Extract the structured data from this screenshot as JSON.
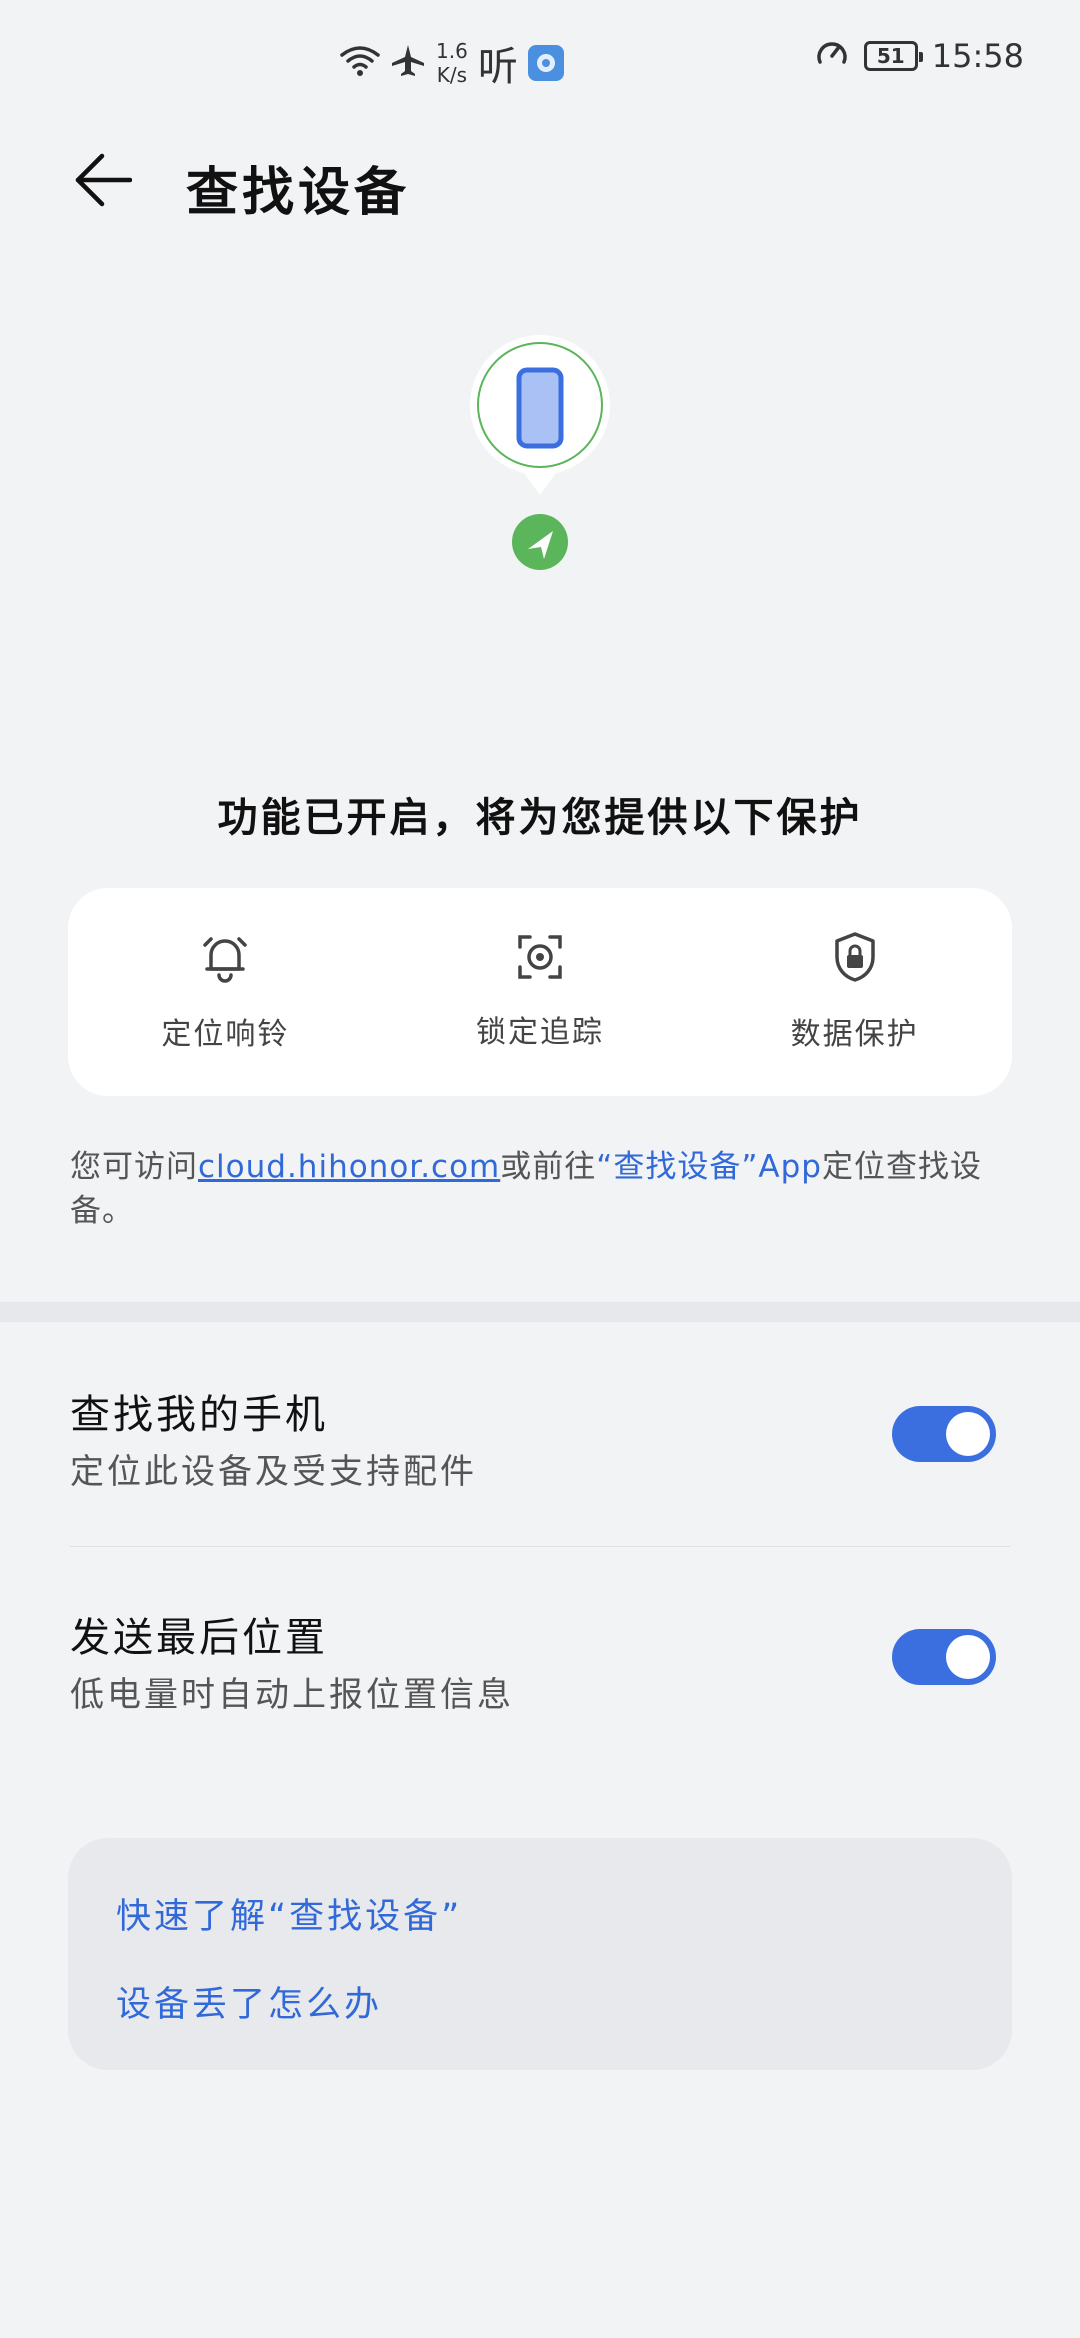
{
  "status_bar": {
    "net_speed_value": "1.6",
    "net_speed_unit": "K/s",
    "ting": "听",
    "battery": "51",
    "time": "15:58"
  },
  "header": {
    "title": "查找设备"
  },
  "tagline": "功能已开启，将为您提供以下保护",
  "features": [
    {
      "label": "定位响铃",
      "icon": "bell-icon"
    },
    {
      "label": "锁定追踪",
      "icon": "target-icon"
    },
    {
      "label": "数据保护",
      "icon": "shield-lock-icon"
    }
  ],
  "info": {
    "prefix": "您可访问",
    "link": "cloud.hihonor.com",
    "middle": "或前往",
    "app_link": "“查找设备”App",
    "suffix": "定位查找设备。"
  },
  "settings": [
    {
      "title": "查找我的手机",
      "subtitle": "定位此设备及受支持配件",
      "enabled": true
    },
    {
      "title": "发送最后位置",
      "subtitle": "低电量时自动上报位置信息",
      "enabled": true
    }
  ],
  "help": {
    "learn": "快速了解“查找设备”",
    "lost": "设备丢了怎么办"
  },
  "colors": {
    "accent": "#3b6fe0",
    "link": "#3269d8",
    "location_green": "#5bb55a",
    "background": "#f1f3f5"
  }
}
